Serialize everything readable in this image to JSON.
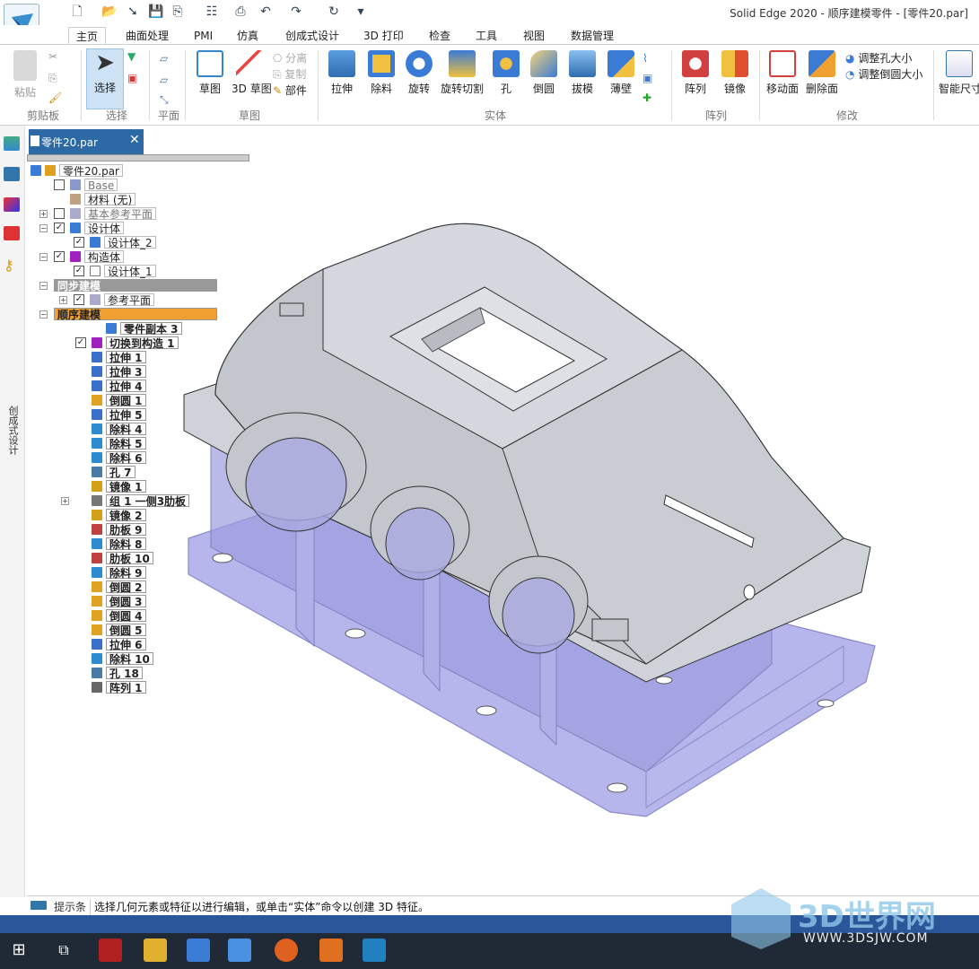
{
  "window": {
    "title": "Solid Edge 2020 - 顺序建模零件 - [零件20.par]"
  },
  "ribbon_tabs": [
    "主页",
    "曲面处理",
    "PMI",
    "仿真",
    "创成式设计",
    "3D 打印",
    "检查",
    "工具",
    "视图",
    "数据管理"
  ],
  "ribbon": {
    "clipboard": {
      "paste": "粘贴",
      "group": "剪贴板"
    },
    "select": {
      "label": "选择",
      "group": "选择"
    },
    "plane": {
      "group": "平面"
    },
    "sketch": {
      "sketch": "草图",
      "sketch3d": "3D 草图",
      "split": "分离",
      "copy": "复制",
      "part": "部件",
      "group": "草图"
    },
    "solid": {
      "extrude": "拉伸",
      "cut": "除料",
      "revolve": "旋转",
      "revolve_cut": "旋转切割",
      "hole": "孔",
      "round": "倒圆",
      "draft": "拔模",
      "thinwall": "薄壁",
      "group": "实体"
    },
    "pattern": {
      "pattern": "阵列",
      "mirror": "镜像",
      "group": "阵列"
    },
    "modify": {
      "move_face": "移动面",
      "delete_face": "删除面",
      "resize_hole": "调整孔大小",
      "resize_round": "调整倒圆大小",
      "group": "修改"
    },
    "smart": {
      "label": "智能尺寸"
    }
  },
  "left_strip": {
    "generative": "创成式设计"
  },
  "document_tab": {
    "label": "零件20.par"
  },
  "tree": {
    "root": "零件20.par",
    "base": "Base",
    "material": "材料 (无)",
    "base_planes": "基本参考平面",
    "design_body": "设计体",
    "design_body_2": "设计体_2",
    "construction_body": "构造体",
    "design_body_1": "设计体_1",
    "sync": "同步建模",
    "ref_plane": "参考平面",
    "ordered": "顺序建模",
    "features": [
      {
        "label": "零件副本 3",
        "color": "#3a7bd5"
      },
      {
        "label": "切换到构造 1",
        "color": "#a020c0"
      },
      {
        "label": "拉伸 1",
        "color": "#3a6fc9"
      },
      {
        "label": "拉伸 3",
        "color": "#3a6fc9"
      },
      {
        "label": "拉伸 4",
        "color": "#3a6fc9"
      },
      {
        "label": "倒圆 1",
        "color": "#e0a020"
      },
      {
        "label": "拉伸 5",
        "color": "#3a6fc9"
      },
      {
        "label": "除料 4",
        "color": "#2e8bd0"
      },
      {
        "label": "除料 5",
        "color": "#2e8bd0"
      },
      {
        "label": "除料 6",
        "color": "#2e8bd0"
      },
      {
        "label": "孔 7",
        "color": "#4a7aa8"
      },
      {
        "label": "镜像 1",
        "color": "#d4a017"
      },
      {
        "label": "组 1 一侧3肋板",
        "color": "#777777"
      },
      {
        "label": "镜像 2",
        "color": "#d4a017"
      },
      {
        "label": "肋板 9",
        "color": "#c04040"
      },
      {
        "label": "除料 8",
        "color": "#2e8bd0"
      },
      {
        "label": "肋板 10",
        "color": "#c04040"
      },
      {
        "label": "除料 9",
        "color": "#2e8bd0"
      },
      {
        "label": "倒圆 2",
        "color": "#e0a020"
      },
      {
        "label": "倒圆 3",
        "color": "#e0a020"
      },
      {
        "label": "倒圆 4",
        "color": "#e0a020"
      },
      {
        "label": "倒圆 5",
        "color": "#e0a020"
      },
      {
        "label": "拉伸 6",
        "color": "#3a6fc9"
      },
      {
        "label": "除料 10",
        "color": "#2e8bd0"
      },
      {
        "label": "孔 18",
        "color": "#4a7aa8"
      },
      {
        "label": "阵列 1",
        "color": "#666666"
      }
    ]
  },
  "prompt": {
    "title": "提示条",
    "text": "选择几何元素或特征以进行编辑，或单击“实体”命令以创建 3D 特征。"
  },
  "watermark": {
    "text": "3D世界网",
    "url": "WWW.3DSJW.COM"
  },
  "colors": {
    "accent": "#2d6aa5",
    "ordered_highlight": "#f0a030",
    "transparent_body": "#9b9bd8",
    "solid_body": "#c9ccd2"
  }
}
